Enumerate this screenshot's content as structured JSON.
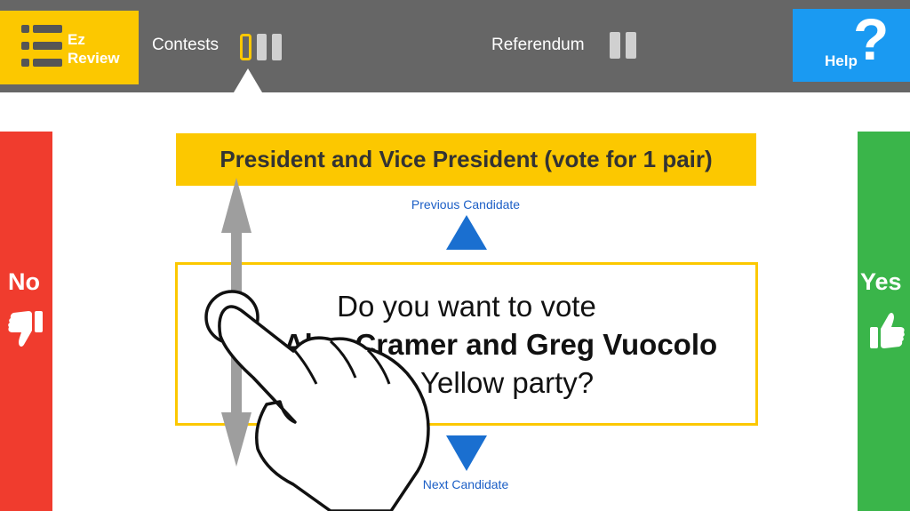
{
  "toolbar": {
    "ez_review_label_line1": "Ez",
    "ez_review_label_line2": "Review",
    "contests_label": "Contests",
    "referendum_label": "Referendum",
    "help_label": "Help",
    "help_glyph": "?"
  },
  "sides": {
    "no_label": "No",
    "yes_label": "Yes"
  },
  "contest": {
    "title": "President and Vice President (vote for 1 pair)",
    "previous_label": "Previous Candidate",
    "next_label": "Next Candidate"
  },
  "question": {
    "line1": "Do you want to vote",
    "line2": "for Alan Cramer and Greg Vuocolo",
    "line3": "of the Yellow party?"
  },
  "colors": {
    "topbar": "#666666",
    "accent_yellow": "#fcc800",
    "help_blue": "#1a9af2",
    "no_red": "#f03c2e",
    "yes_green": "#3ab54a",
    "link_blue": "#1c5fc6"
  },
  "icons": {
    "ez_review": "list-icon",
    "no": "thumbs-down-icon",
    "yes": "thumbs-up-icon",
    "previous": "triangle-up-icon",
    "next": "triangle-down-icon",
    "gesture": "hand-swipe-icon"
  }
}
